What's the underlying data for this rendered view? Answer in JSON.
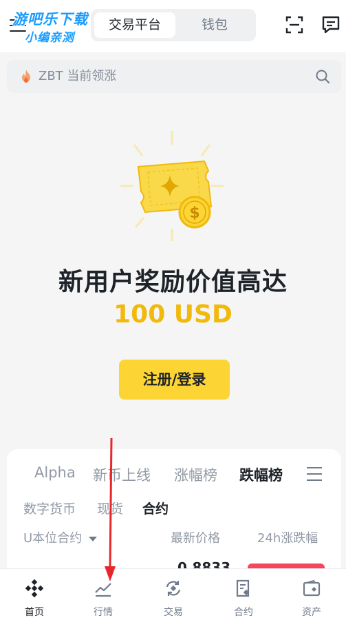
{
  "watermark": {
    "line1": "游吧乐下载",
    "line2": "小编亲测"
  },
  "header": {
    "tabs": [
      {
        "label": "交易平台",
        "active": true
      },
      {
        "label": "钱包",
        "active": false
      }
    ],
    "scan_icon": "scan-icon",
    "chat_icon": "chat-icon"
  },
  "search": {
    "placeholder": "ZBT 当前领涨",
    "icon": "search-icon"
  },
  "promo": {
    "title": "新用户奖励价值高达",
    "amount": "100 USD",
    "button_label": "注册/登录",
    "accent": "#f0b90b",
    "button_color": "#fcd535"
  },
  "market": {
    "category_tabs": [
      {
        "label": "Alpha",
        "active": false
      },
      {
        "label": "新币上线",
        "active": false
      },
      {
        "label": "涨幅榜",
        "active": false
      },
      {
        "label": "跌幅榜",
        "active": true
      }
    ],
    "sub_tabs": [
      {
        "label": "数字货币",
        "active": false
      },
      {
        "label": "现货",
        "active": false
      },
      {
        "label": "合约",
        "active": true
      }
    ],
    "filter_label": "U本位合约",
    "col_price": "最新价格",
    "col_change": "24h涨跌幅",
    "first_row_price": "0.8833",
    "down_color": "#f6465d"
  },
  "bottom_nav": [
    {
      "label": "首页",
      "icon": "home-icon",
      "active": true
    },
    {
      "label": "行情",
      "icon": "markets-icon",
      "active": false
    },
    {
      "label": "交易",
      "icon": "trade-icon",
      "active": false
    },
    {
      "label": "合约",
      "icon": "futures-icon",
      "active": false
    },
    {
      "label": "资产",
      "icon": "wallet-icon",
      "active": false
    }
  ]
}
